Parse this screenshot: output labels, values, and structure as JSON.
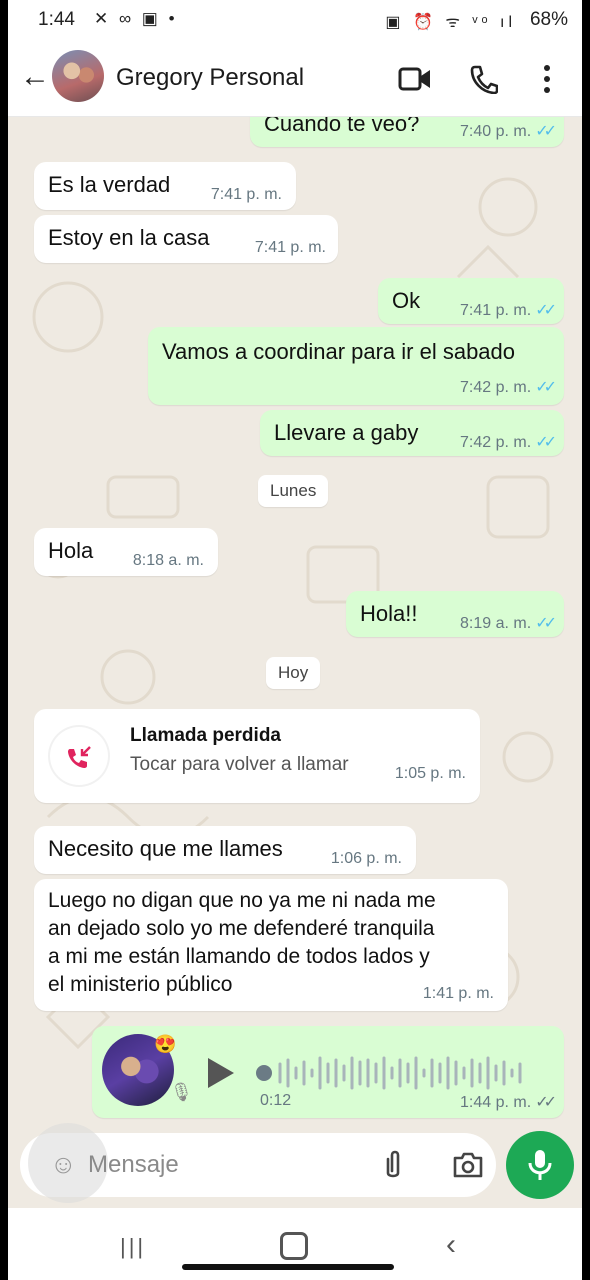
{
  "status_bar": {
    "time": "1:44",
    "left_icons": "✕ ∞ ▣ •",
    "right_icons": "▣ ⏰ ᯤ ᵛᵒ ıl",
    "battery": "68%"
  },
  "header": {
    "contact_name": "Gregory Personal",
    "icons": [
      "back-arrow-icon",
      "video-call-icon",
      "phone-call-icon",
      "more-options-icon"
    ]
  },
  "messages": [
    {
      "dir": "out",
      "text": "Cuando te veo?",
      "time": "7:40 p. m.",
      "ticks": "✓✓",
      "read": true
    },
    {
      "dir": "in",
      "text": "Es la verdad",
      "time": "7:41 p. m."
    },
    {
      "dir": "in",
      "text": "Estoy en la casa",
      "time": "7:41 p. m."
    },
    {
      "dir": "out",
      "text": "Ok",
      "time": "7:41 p. m.",
      "ticks": "✓✓",
      "read": true
    },
    {
      "dir": "out",
      "text": "Vamos a coordinar para ir el sabado",
      "time": "7:42 p. m.",
      "ticks": "✓✓",
      "read": true
    },
    {
      "dir": "out",
      "text": "Llevare a gaby",
      "time": "7:42 p. m.",
      "ticks": "✓✓",
      "read": true
    },
    {
      "dir": "in",
      "text": "Hola",
      "time": "8:18 a. m."
    },
    {
      "dir": "out",
      "text": "Hola!!",
      "time": "8:19 a. m.",
      "ticks": "✓✓",
      "read": true
    },
    {
      "dir": "in",
      "text": "Necesito que me llames",
      "time": "1:06 p. m."
    },
    {
      "dir": "in",
      "lines": [
        "Luego no digan que no ya me ni nada me",
        "an dejado solo yo me defenderé tranquila",
        "a mi me están llamando de todos lados y",
        "el ministerio público"
      ],
      "time": "1:41 p. m."
    }
  ],
  "date_chips": {
    "monday": "Lunes",
    "today": "Hoy"
  },
  "missed_call": {
    "title": "Llamada perdida",
    "subtitle": "Tocar para volver a llamar",
    "time": "1:05 p. m."
  },
  "voice_note": {
    "duration": "0:12",
    "time": "1:44 p. m.",
    "ticks": "✓✓",
    "read": false,
    "avatar_emoji": "😍"
  },
  "composer": {
    "placeholder": "Mensaje"
  },
  "colors": {
    "outgoing": "#d9fdd3",
    "incoming": "#ffffff",
    "background": "#efeae2",
    "read_ticks": "#53bdeb",
    "mic_button": "#1da955",
    "missed_call": "#e0245e"
  }
}
